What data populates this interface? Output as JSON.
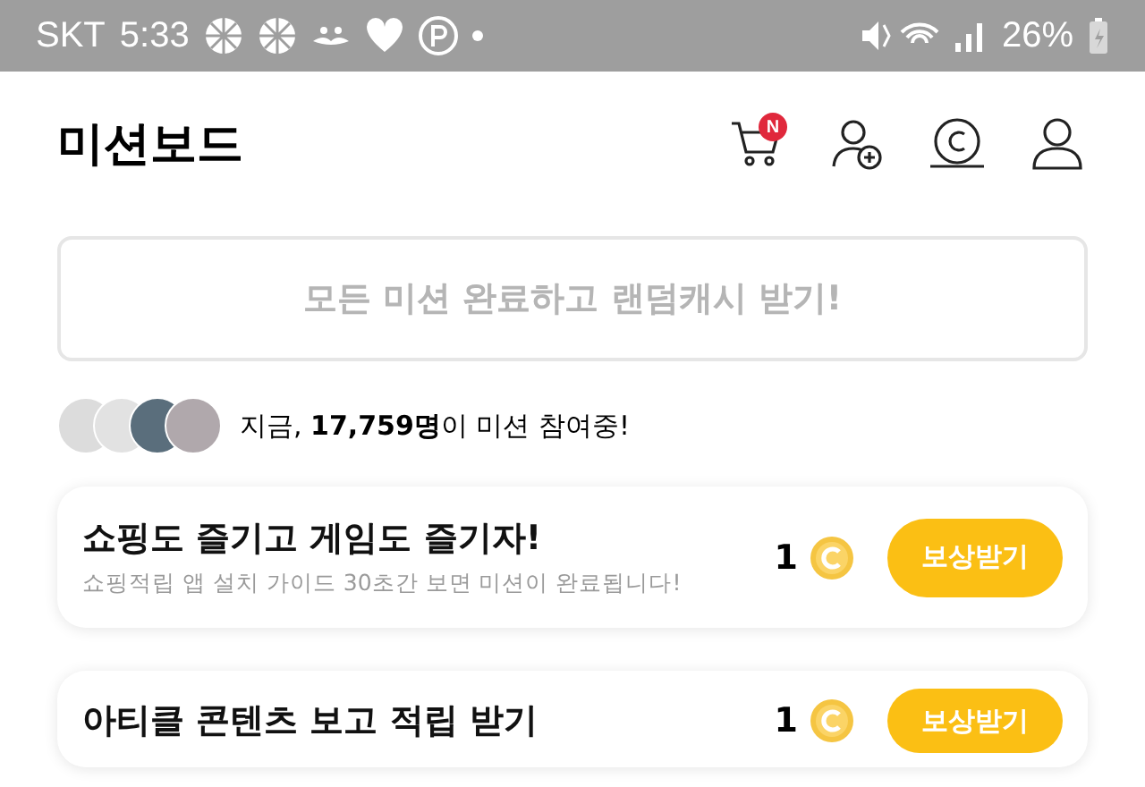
{
  "status_bar": {
    "carrier": "SKT",
    "time": "5:33",
    "battery": "26%"
  },
  "header": {
    "title": "미션보드",
    "cart_badge": "N"
  },
  "banner": {
    "label": "모든 미션 완료하고 랜덤캐시 받기!"
  },
  "participants": {
    "text": "지금, **17,759명**이 미션 참여중!"
  },
  "missions": [
    {
      "title": "쇼핑도 즐기고 게임도 즐기자!",
      "subtitle": "쇼핑적립 앱 설치 가이드 30초간 보면 미션이 완료됩니다!",
      "reward": "1",
      "button": "보상받기"
    },
    {
      "title": "아티클 콘텐츠 보고 적립 받기",
      "reward": "1",
      "button": "보상받기"
    }
  ]
}
